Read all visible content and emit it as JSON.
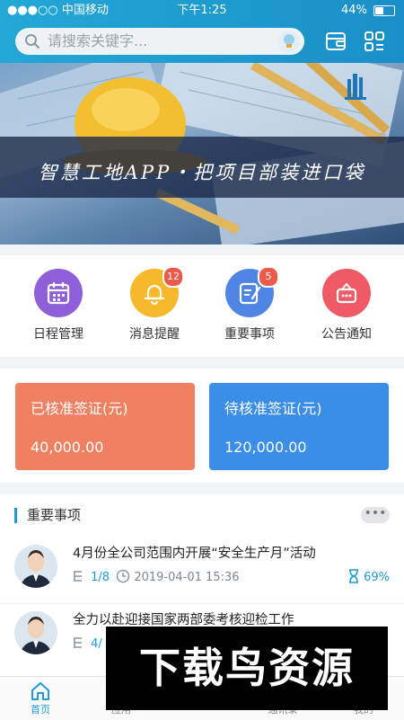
{
  "status_bar": {
    "carrier": "●●●○○ 中国移动",
    "time": "下午1:25",
    "battery": "44%",
    "battery_level": 0.44
  },
  "header": {
    "search_placeholder": "请搜索关键字...",
    "icons": [
      "search-icon",
      "voice-icon",
      "wallet-icon",
      "scan-apps-icon"
    ]
  },
  "banner": {
    "slogan": "智慧工地APP・把项目部装进口袋",
    "logo": "building-logo-icon"
  },
  "quick_actions": [
    {
      "label": "日程管理",
      "icon": "calendar-icon",
      "color": "#8f5fd9",
      "badge": ""
    },
    {
      "label": "消息提醒",
      "icon": "bell-icon",
      "color": "#f5b92b",
      "badge": "12"
    },
    {
      "label": "重要事项",
      "icon": "edit-note-icon",
      "color": "#4f86e6",
      "badge": "5"
    },
    {
      "label": "公告通知",
      "icon": "megaphone-icon",
      "color": "#ef5a67",
      "badge": ""
    }
  ],
  "finance": {
    "approved": {
      "title": "已核准签证(元)",
      "value": "40,000.00",
      "color": "#ef8061"
    },
    "pending": {
      "title": "待核准签证(元)",
      "value": "120,000.00",
      "color": "#3a8ee8"
    }
  },
  "important": {
    "section_title": "重要事项",
    "more": "•••",
    "items": [
      {
        "title": "4月份全公司范围内开展“安全生产月”活动",
        "count": "1/8",
        "date": "2019-04-01 15:36",
        "percent": "69%"
      },
      {
        "title": "全力以赴迎接国家两部委考核迎检工作",
        "count": "4/",
        "date": "",
        "percent": ""
      }
    ]
  },
  "bottom_nav": [
    {
      "label": "首页",
      "icon": "home-icon",
      "active": true
    },
    {
      "label": "应用",
      "icon": "apps-icon",
      "active": false
    },
    {
      "label": "通讯录",
      "icon": "contacts-icon",
      "active": false
    },
    {
      "label": "我的",
      "icon": "user-icon",
      "active": false
    }
  ],
  "watermark": "下载鸟资源"
}
